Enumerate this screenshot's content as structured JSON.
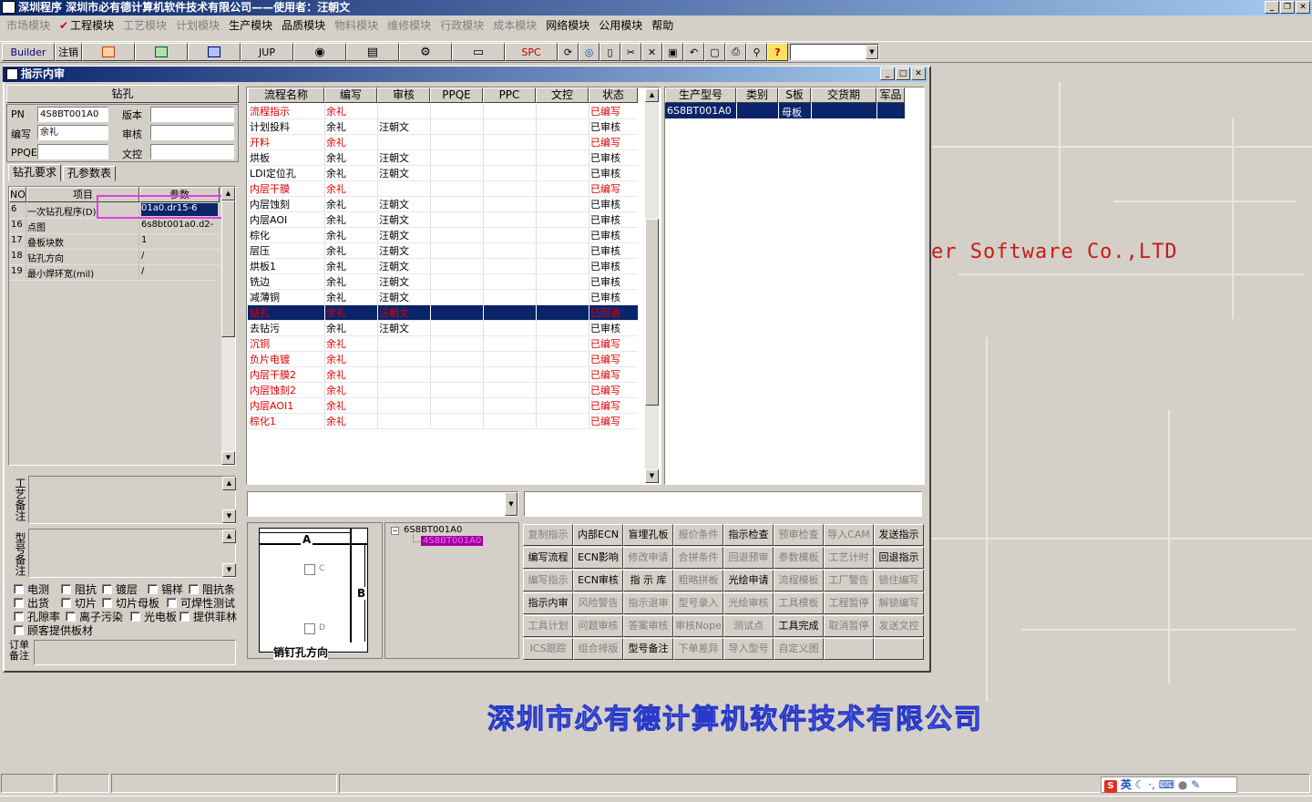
{
  "window": {
    "title": "深圳程序    深圳市必有德计算机软件技术有限公司——使用者：汪朝文"
  },
  "menu": [
    {
      "label": "市场模块",
      "enabled": false
    },
    {
      "label": "工程模块",
      "enabled": true,
      "checked": true
    },
    {
      "label": "工艺模块",
      "enabled": false
    },
    {
      "label": "计划模块",
      "enabled": false
    },
    {
      "label": "生产模块",
      "enabled": true
    },
    {
      "label": "品质模块",
      "enabled": true
    },
    {
      "label": "物料模块",
      "enabled": false
    },
    {
      "label": "维修模块",
      "enabled": false
    },
    {
      "label": "行政模块",
      "enabled": false
    },
    {
      "label": "成本模块",
      "enabled": false
    },
    {
      "label": "网络模块",
      "enabled": true
    },
    {
      "label": "公用模块",
      "enabled": true
    },
    {
      "label": "帮助",
      "enabled": true
    }
  ],
  "toolbar": {
    "builder": "Builder",
    "logout": "注销",
    "jup": "JUP",
    "spc": "SPC"
  },
  "child": {
    "title": "指示内审"
  },
  "left": {
    "section_title": "钻孔",
    "pn_label": "PN",
    "pn_value": "4S8BT001A0",
    "version_label": "版本",
    "version_value": "",
    "author_label": "编写",
    "author_value": "余礼",
    "review_label": "审核",
    "review_value": "",
    "ppqe_label": "PPQE",
    "ppqe_value": "",
    "doc_label": "文控",
    "doc_value": "",
    "tabs": [
      "钻孔要求",
      "孔参数表"
    ],
    "param_headers": [
      "NO",
      "项目",
      "参数"
    ],
    "params": [
      {
        "no": "6",
        "item": "一次钻孔程序(D)",
        "value": "01a0.dr15-6"
      },
      {
        "no": "16",
        "item": "点图",
        "value": "6s8bt001a0.d2-"
      },
      {
        "no": "17",
        "item": "叠板块数",
        "value": "1"
      },
      {
        "no": "18",
        "item": "钻孔方向",
        "value": "/"
      },
      {
        "no": "19",
        "item": "最小焊环宽(mil)",
        "value": "/"
      }
    ],
    "process_note_label": "工艺备注",
    "model_note_label": "型号备注",
    "order_note_label": "订单备注",
    "checks": [
      [
        "电测",
        "阻抗",
        "镀层",
        "锡样",
        "阻抗条"
      ],
      [
        "出货",
        "切片",
        "切片母板",
        "可焊性测试"
      ],
      [
        "孔隙率",
        "离子污染",
        "光电板",
        "提供菲林"
      ],
      [
        "顾客提供板材"
      ]
    ]
  },
  "process": {
    "headers": [
      "流程名称",
      "编写",
      "审核",
      "PPQE",
      "PPC",
      "文控",
      "状态"
    ],
    "rows": [
      {
        "name": "流程指示",
        "author": "余礼",
        "reviewer": "",
        "status": "已编写",
        "red": true
      },
      {
        "name": "计划投料",
        "author": "余礼",
        "reviewer": "汪朝文",
        "status": "已审核",
        "red": false
      },
      {
        "name": "开料",
        "author": "余礼",
        "reviewer": "",
        "status": "已编写",
        "red": true
      },
      {
        "name": "烘板",
        "author": "余礼",
        "reviewer": "汪朝文",
        "status": "已审核",
        "red": false
      },
      {
        "name": "LDI定位孔",
        "author": "余礼",
        "reviewer": "汪朝文",
        "status": "已审核",
        "red": false
      },
      {
        "name": "内层干膜",
        "author": "余礼",
        "reviewer": "",
        "status": "已编写",
        "red": true
      },
      {
        "name": "内层蚀刻",
        "author": "余礼",
        "reviewer": "汪朝文",
        "status": "已审核",
        "red": false
      },
      {
        "name": "内层AOI",
        "author": "余礼",
        "reviewer": "汪朝文",
        "status": "已审核",
        "red": false
      },
      {
        "name": "棕化",
        "author": "余礼",
        "reviewer": "汪朝文",
        "status": "已审核",
        "red": false
      },
      {
        "name": "层压",
        "author": "余礼",
        "reviewer": "汪朝文",
        "status": "已审核",
        "red": false
      },
      {
        "name": "烘板1",
        "author": "余礼",
        "reviewer": "汪朝文",
        "status": "已审核",
        "red": false
      },
      {
        "name": "铣边",
        "author": "余礼",
        "reviewer": "汪朝文",
        "status": "已审核",
        "red": false
      },
      {
        "name": "减薄铜",
        "author": "余礼",
        "reviewer": "汪朝文",
        "status": "已审核",
        "red": false
      },
      {
        "name": "钻孔",
        "author": "余礼",
        "reviewer": "汪朝文",
        "status": "已回退",
        "red": true,
        "selected": true
      },
      {
        "name": "去钻污",
        "author": "余礼",
        "reviewer": "汪朝文",
        "status": "已审核",
        "red": false
      },
      {
        "name": "沉铜",
        "author": "余礼",
        "reviewer": "",
        "status": "已编写",
        "red": true
      },
      {
        "name": "负片电镀",
        "author": "余礼",
        "reviewer": "",
        "status": "已编写",
        "red": true
      },
      {
        "name": "内层干膜2",
        "author": "余礼",
        "reviewer": "",
        "status": "已编写",
        "red": true
      },
      {
        "name": "内层蚀刻2",
        "author": "余礼",
        "reviewer": "",
        "status": "已编写",
        "red": true
      },
      {
        "name": "内层AOI1",
        "author": "余礼",
        "reviewer": "",
        "status": "已编写",
        "red": true
      },
      {
        "name": "棕化1",
        "author": "余礼",
        "reviewer": "",
        "status": "已编写",
        "red": true
      }
    ]
  },
  "production": {
    "headers": [
      "生产型号",
      "类别",
      "S板",
      "交货期",
      "军品"
    ],
    "rows": [
      {
        "model": "6S8BT001A0",
        "category": "",
        "sboard": "母板",
        "delivery": "",
        "military": ""
      }
    ]
  },
  "diagram": {
    "label_a": "A",
    "label_b": "B",
    "label_c": "C",
    "label_d": "D",
    "caption": "销钉孔方向"
  },
  "tree": {
    "root": "6S8BT001A0",
    "child": "4S8BT001A0"
  },
  "buttons": [
    [
      {
        "l": "复制指示",
        "e": false
      },
      {
        "l": "内部ECN",
        "e": true
      },
      {
        "l": "盲埋孔板",
        "e": true
      },
      {
        "l": "报价条件",
        "e": false
      },
      {
        "l": "指示检查",
        "e": true
      },
      {
        "l": "预审检查",
        "e": false
      },
      {
        "l": "导入CAM",
        "e": false
      },
      {
        "l": "发送指示",
        "e": true
      }
    ],
    [
      {
        "l": "编写流程",
        "e": true
      },
      {
        "l": "ECN影响",
        "e": true
      },
      {
        "l": "修改申请",
        "e": false
      },
      {
        "l": "合拼条件",
        "e": false
      },
      {
        "l": "回退预审",
        "e": false
      },
      {
        "l": "参数模板",
        "e": false
      },
      {
        "l": "工艺计时",
        "e": false
      },
      {
        "l": "回退指示",
        "e": true
      }
    ],
    [
      {
        "l": "编写指示",
        "e": false
      },
      {
        "l": "ECN审核",
        "e": true
      },
      {
        "l": "指 示 库",
        "e": true
      },
      {
        "l": "粗略拼板",
        "e": false
      },
      {
        "l": "光绘申请",
        "e": true
      },
      {
        "l": "流程模板",
        "e": false
      },
      {
        "l": "工厂警告",
        "e": false
      },
      {
        "l": "锁住编写",
        "e": false
      }
    ],
    [
      {
        "l": "指示内审",
        "e": true
      },
      {
        "l": "风险警告",
        "e": false
      },
      {
        "l": "指示退审",
        "e": false
      },
      {
        "l": "型号录入",
        "e": false
      },
      {
        "l": "光绘审核",
        "e": false
      },
      {
        "l": "工具模板",
        "e": false
      },
      {
        "l": "工程暂停",
        "e": false
      },
      {
        "l": "解锁编写",
        "e": false
      }
    ],
    [
      {
        "l": "工具计划",
        "e": false
      },
      {
        "l": "问题审核",
        "e": false
      },
      {
        "l": "答案审核",
        "e": false
      },
      {
        "l": "审核Nope",
        "e": false
      },
      {
        "l": "测试点",
        "e": false
      },
      {
        "l": "工具完成",
        "e": true
      },
      {
        "l": "取消暂停",
        "e": false
      },
      {
        "l": "发送文控",
        "e": false
      }
    ],
    [
      {
        "l": "ICS跟踪",
        "e": false
      },
      {
        "l": "组合排版",
        "e": false
      },
      {
        "l": "型号备注",
        "e": true
      },
      {
        "l": "下单差异",
        "e": false
      },
      {
        "l": "导入型号",
        "e": false
      },
      {
        "l": "自定义图",
        "e": false
      },
      {
        "l": "",
        "e": false
      },
      {
        "l": "",
        "e": false
      }
    ]
  ],
  "background": {
    "software_text": "er Software Co.,LTD",
    "company_text": "深圳市必有德计算机软件技术有限公司"
  },
  "ime": {
    "text": "英"
  }
}
